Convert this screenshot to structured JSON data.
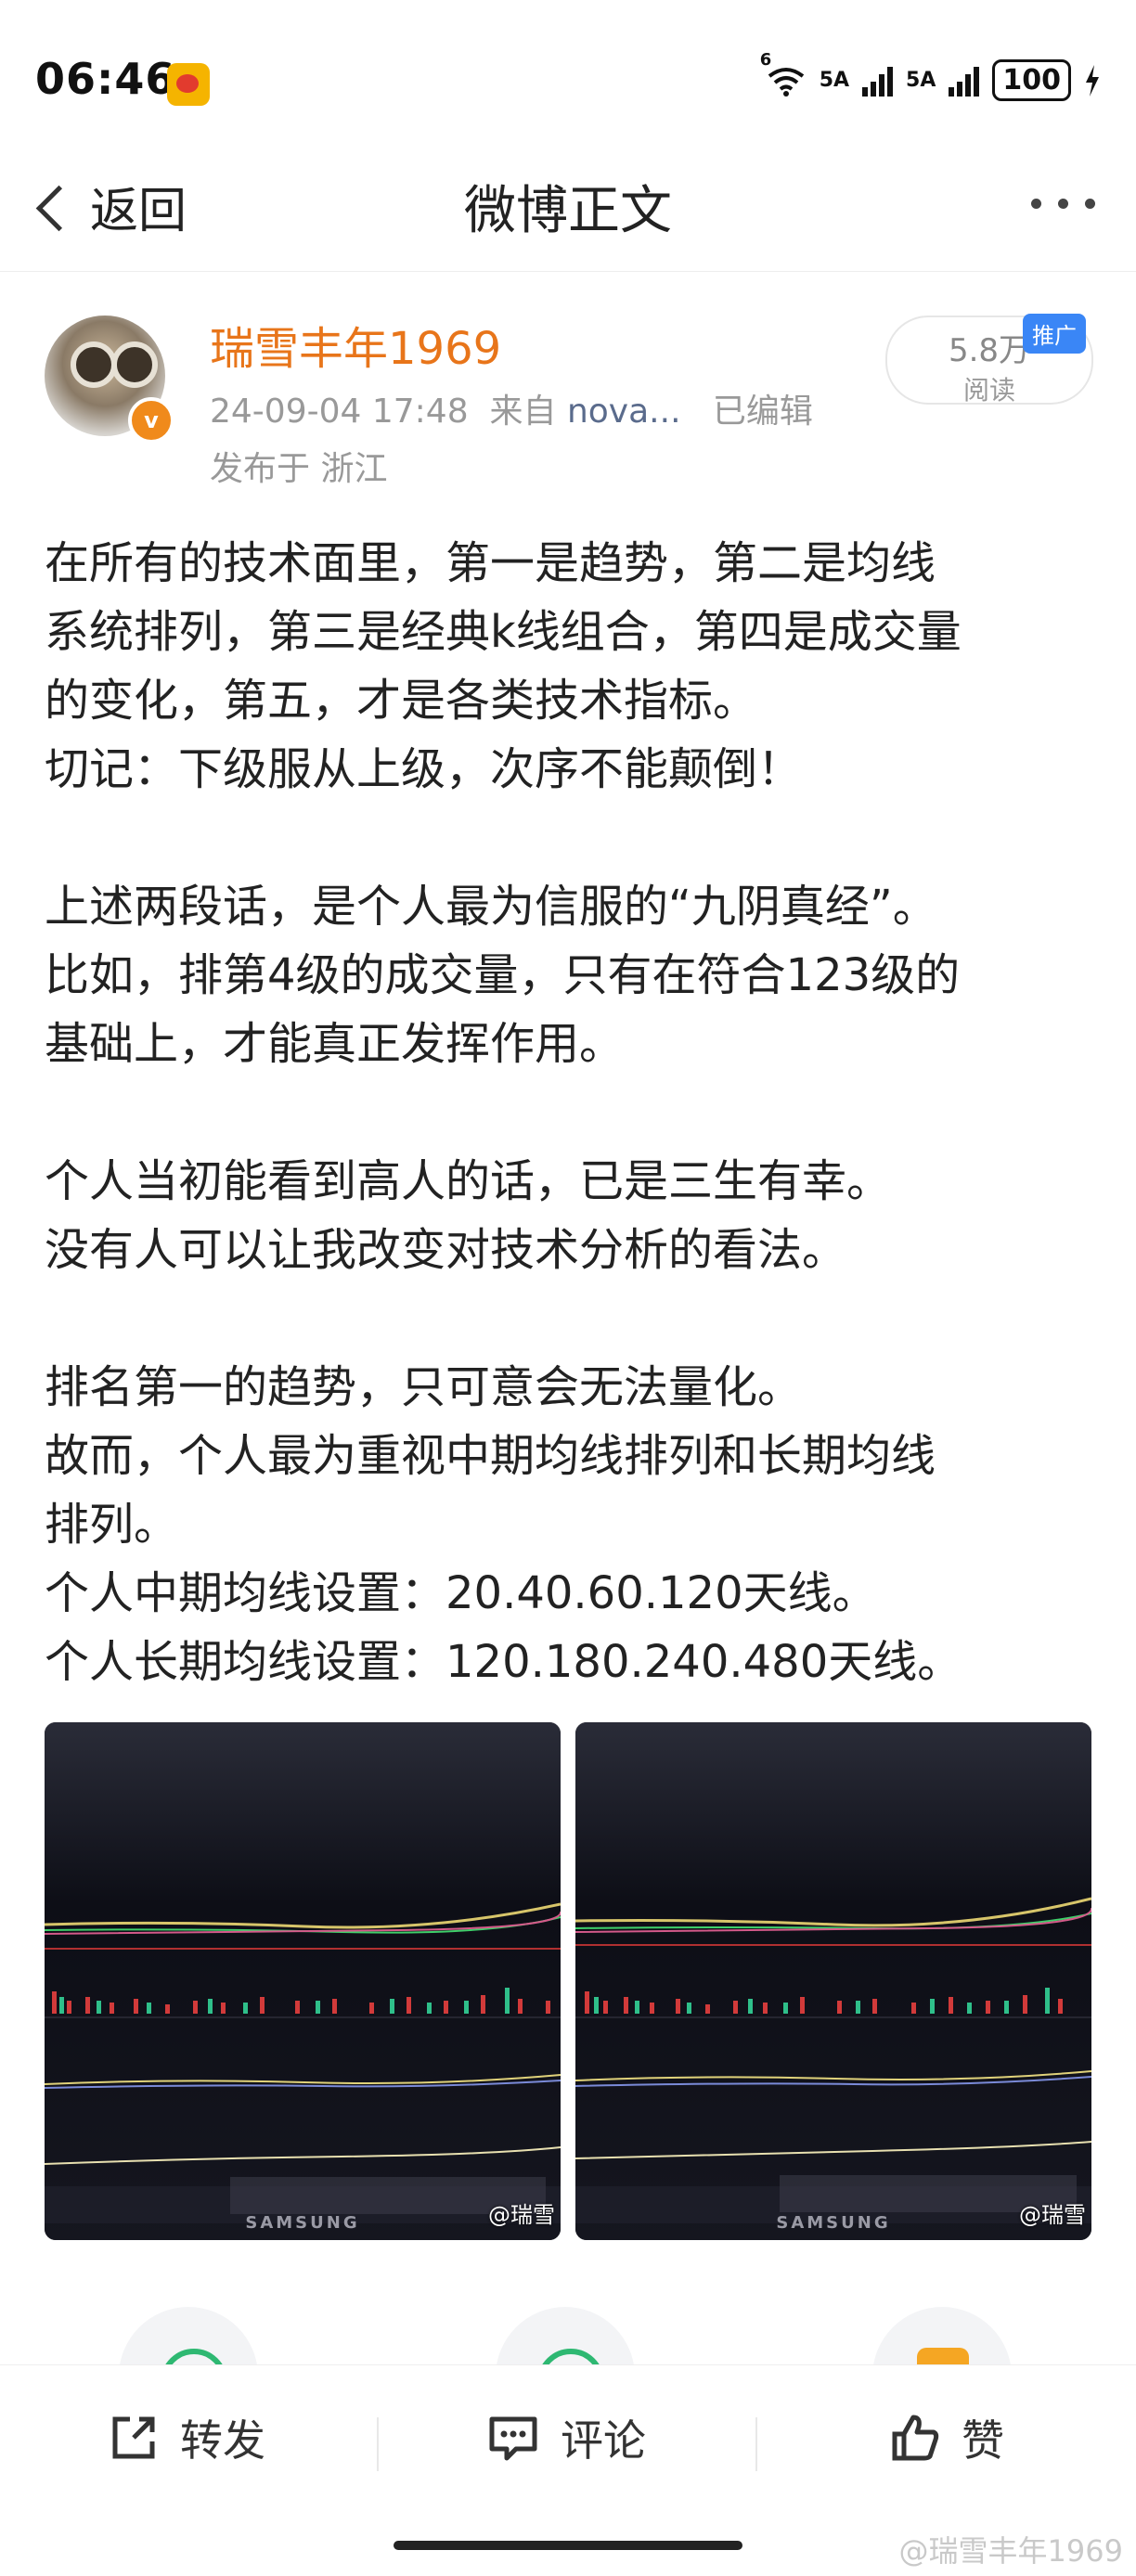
{
  "status_bar": {
    "time": "06:46",
    "net1": "6",
    "net2": "5A",
    "net3": "5A",
    "battery": "100"
  },
  "nav": {
    "back_label": "返回",
    "title": "微博正文"
  },
  "author": {
    "name": "瑞雪丰年1969",
    "verified_badge": "v",
    "time": "24-09-04 17:48",
    "source_prefix": "来自",
    "source": "nova...",
    "edited": "已编辑",
    "location": "发布于 浙江",
    "reads_value": "5.8万",
    "reads_label": "阅读",
    "promo_tag": "推广"
  },
  "post": {
    "lines": [
      "在所有的技术面里，第一是趋势，第二是均线",
      "系统排列，第三是经典k线组合，第四是成交量",
      "的变化，第五，才是各类技术指标。",
      "切记：下级服从上级，次序不能颠倒！",
      "上述两段话，是个人最为信服的“九阴真经”。",
      "比如，排第4级的成交量，只有在符合123级的",
      "基础上，才能真正发挥作用。",
      "个人当初能看到高人的话，已是三生有幸。",
      "没有人可以让我改变对技术分析的看法。",
      "排名第一的趋势，只可意会无法量化。",
      "故而，个人最为重视中期均线排列和长期均线",
      "排列。",
      "个人中期均线设置：20.40.60.120天线。",
      "个人长期均线设置：120.180.240.480天线。"
    ]
  },
  "images": {
    "left_watermark": "@瑞雪",
    "right_watermark": "@瑞雪",
    "right_brand": "SAMSUNG",
    "left_brand": "SAMSUNG"
  },
  "actions": {
    "repost": "转发",
    "comment": "评论",
    "like": "赞"
  },
  "footer_watermark": "@瑞雪丰年1969",
  "colors": {
    "author_name": "#e8751a",
    "promo": "#3a86f6",
    "verified": "#f08a1b"
  }
}
